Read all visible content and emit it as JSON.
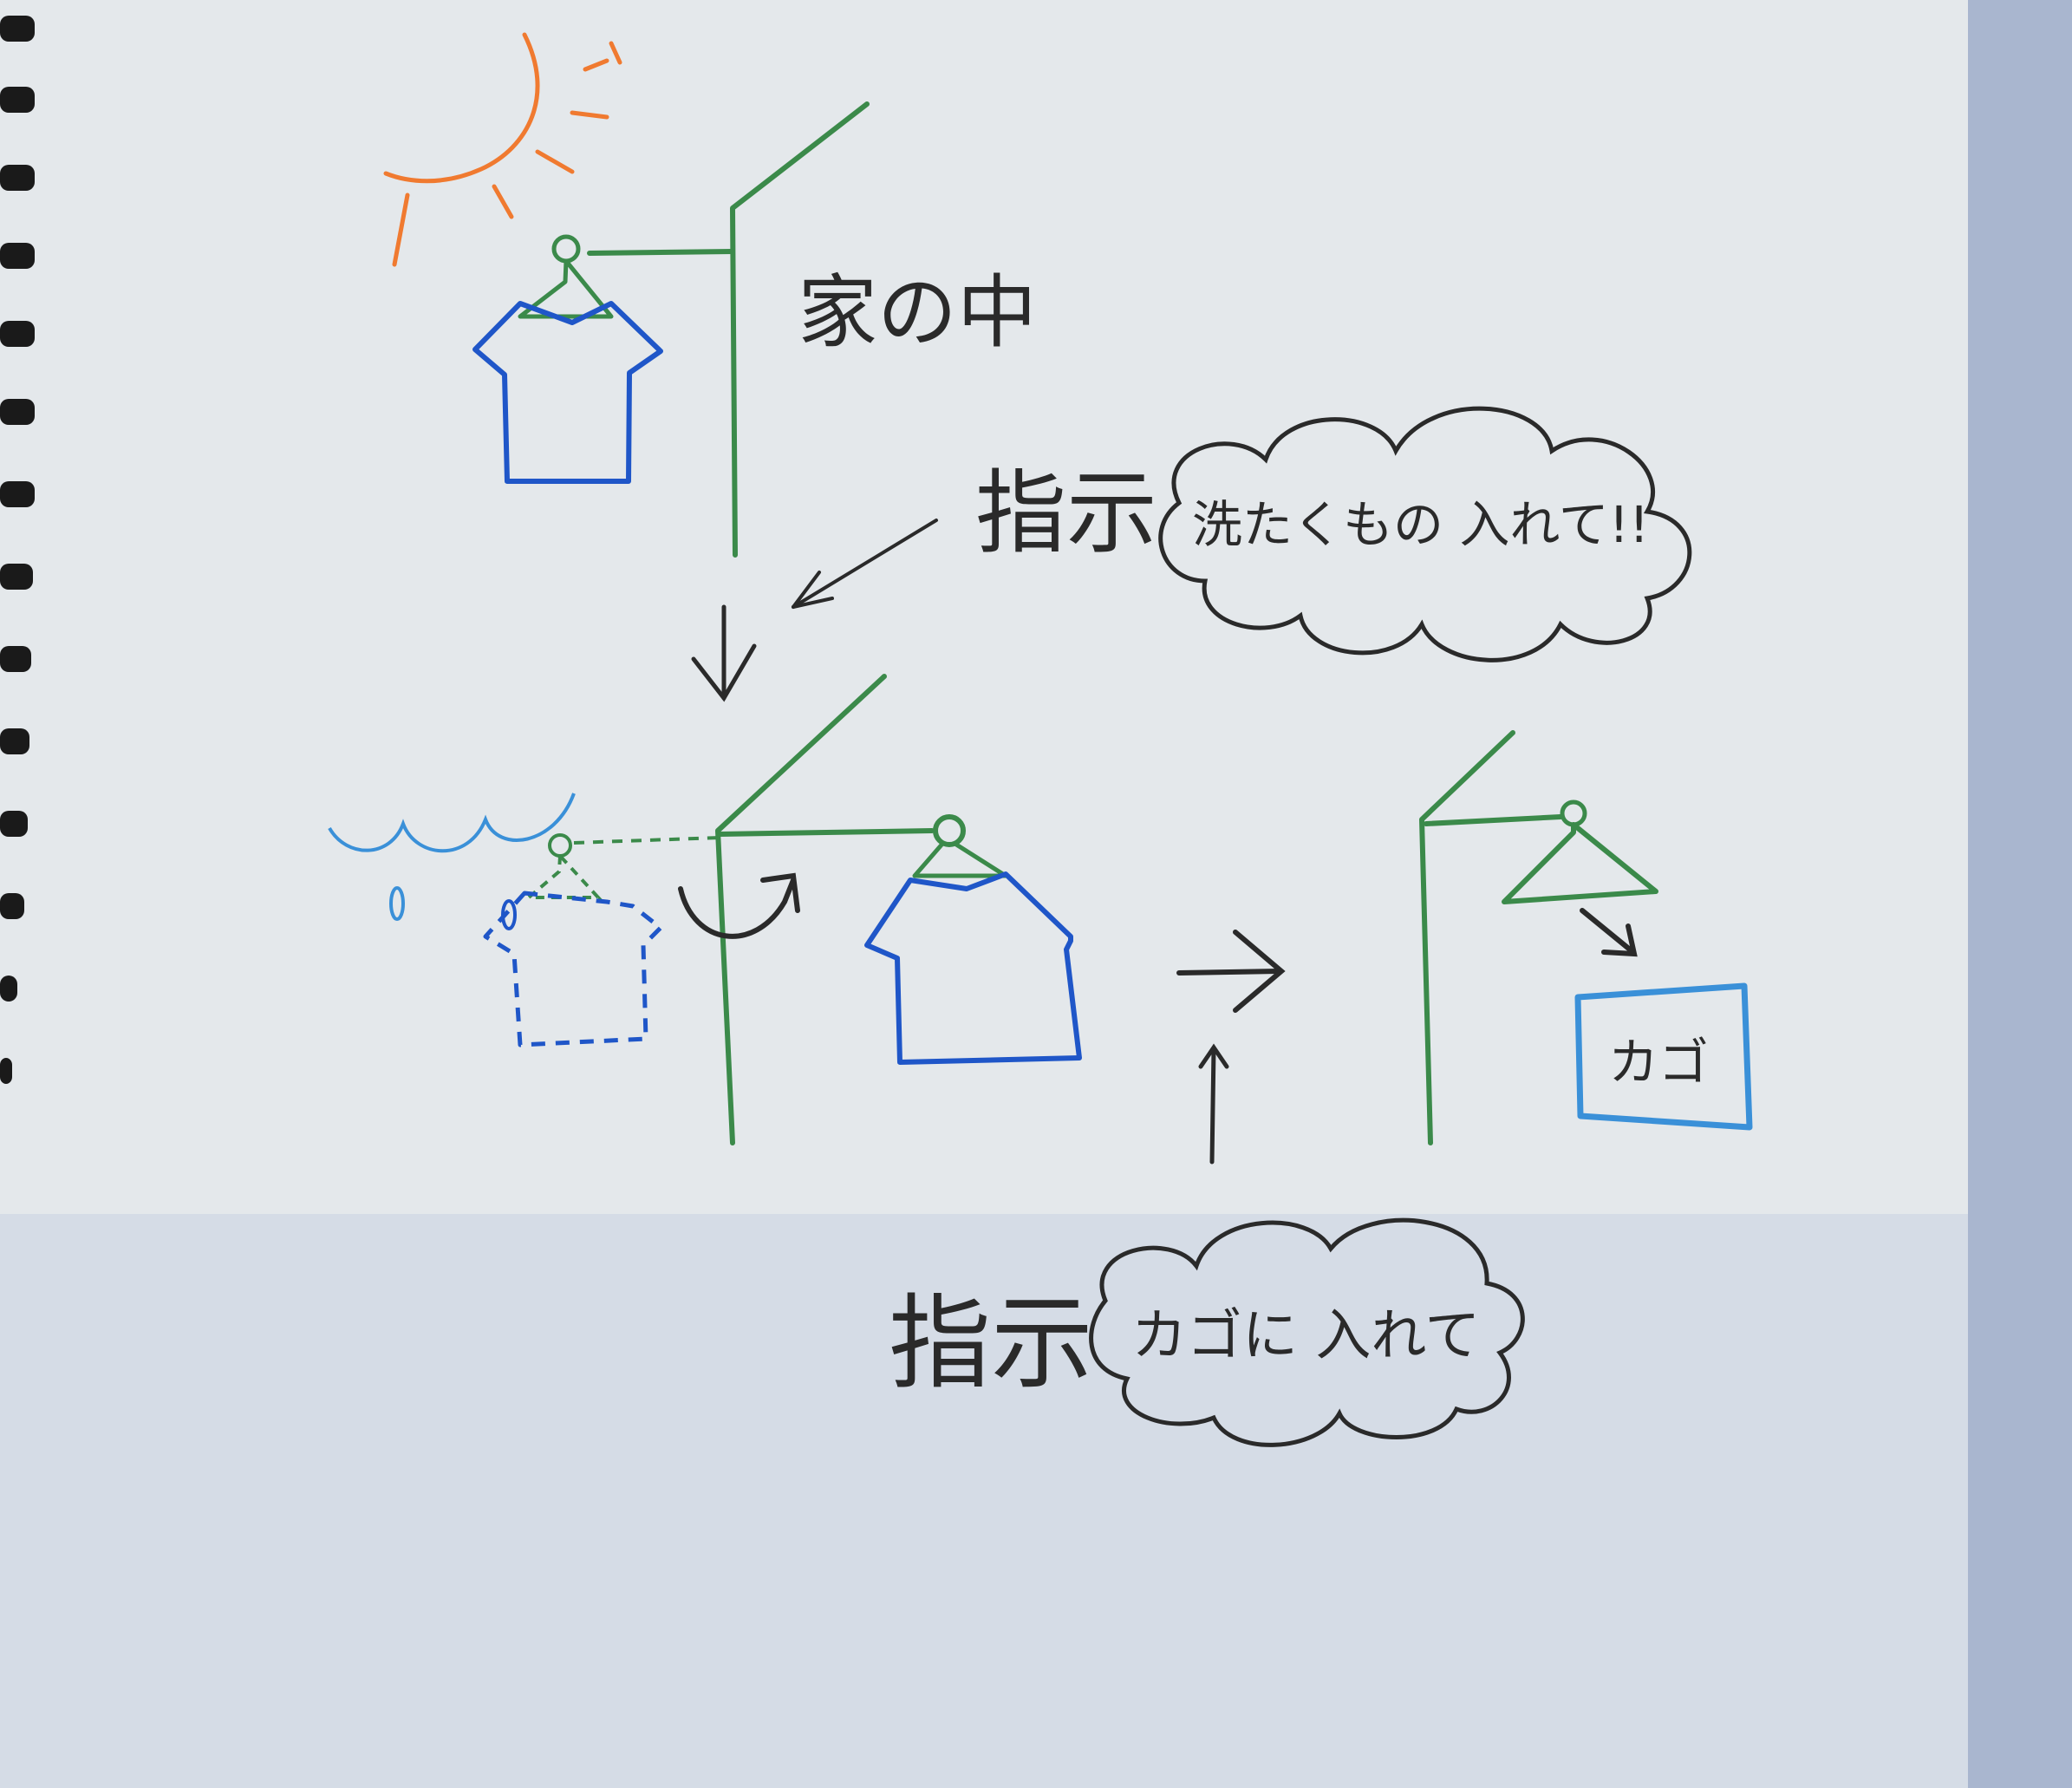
{
  "labels": {
    "inside_house": "家の中",
    "instruction_1": "指示",
    "bubble_1": "洗たくもの 入れて!!",
    "basket": "カゴ",
    "instruction_2": "指示",
    "bubble_2": "カゴに 入れて"
  },
  "colors": {
    "paper": "#e3e7ea",
    "wall_pole": "#3b8a4a",
    "shirt": "#1f56c8",
    "rain": "#3a90d8",
    "sun": "#f07a30",
    "ink": "#2a2a2a",
    "basket_border": "#3a90d8"
  }
}
